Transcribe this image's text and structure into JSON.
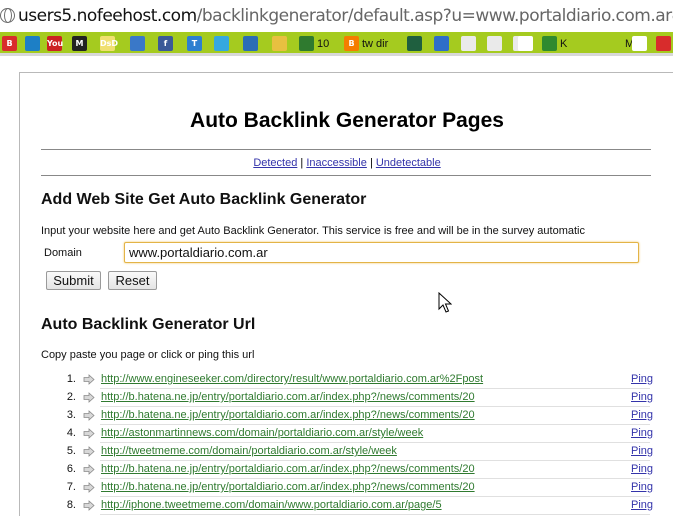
{
  "address_bar": {
    "host": "users5.nofeehost.com",
    "path": "/backlinkgenerator/default.asp?u=www.portaldiario.com.ar&btnkirim=Submit"
  },
  "bookmarks": [
    {
      "icon": "red-b-icon",
      "color": "#d82c2c",
      "text": "B"
    },
    {
      "icon": "blue-square-icon",
      "color": "#1d7fc6",
      "text": ""
    },
    {
      "icon": "youtube-icon",
      "color": "#cc2222",
      "text": "You"
    },
    {
      "icon": "m-icon",
      "color": "#222222",
      "text": "M"
    },
    {
      "icon": "dd-icon",
      "color": "#f0e070",
      "text": "DsD"
    },
    {
      "icon": "globe-icon",
      "color": "#3a78c8",
      "text": ""
    },
    {
      "icon": "facebook-icon",
      "color": "#3b5998",
      "text": "f"
    },
    {
      "icon": "t-icon",
      "color": "#2d7fd0",
      "text": "T"
    },
    {
      "icon": "twitter-icon",
      "color": "#35a8e0",
      "text": ""
    },
    {
      "icon": "circle-icon",
      "color": "#2c6db5",
      "text": ""
    },
    {
      "icon": "smiley-icon",
      "color": "#e8c040",
      "text": ""
    },
    {
      "icon": "clock-icon",
      "color": "#2f7a2f",
      "text": "",
      "label": "10"
    },
    {
      "icon": "blogger-icon",
      "color": "#f57d00",
      "text": "B",
      "label": "tw dir"
    },
    {
      "icon": "gear-icon",
      "color": "#1f5f3f",
      "text": ""
    },
    {
      "icon": "arrow-icon",
      "color": "#2e6ec8",
      "text": ""
    },
    {
      "icon": "page-icon",
      "color": "#eaeaea",
      "text": ""
    },
    {
      "icon": "page-icon",
      "color": "#eaeaea",
      "text": ""
    },
    {
      "icon": "page-icon",
      "color": "#eaeaea",
      "text": ""
    },
    {
      "icon": "skull-icon",
      "color": "#ffffff",
      "text": ""
    },
    {
      "icon": "k-icon",
      "color": "#2f8a2f",
      "text": "",
      "label": "K"
    },
    {
      "icon": "m-letter-icon",
      "color": "#a5cb1f",
      "text": "",
      "label": "M"
    },
    {
      "icon": "hat-icon",
      "color": "#ffffff",
      "text": ""
    },
    {
      "icon": "star-icon",
      "color": "#d82c2c",
      "text": ""
    }
  ],
  "page": {
    "title": "Auto Backlink Generator Pages",
    "links": [
      "Detected",
      "Inaccessible",
      "Undetectable"
    ],
    "separator": "|",
    "add_heading": "Add Web Site Get Auto Backlink Generator",
    "intro": "Input your website here and get Auto Backlink Generator. This service is free and will be in the survey automatic",
    "domain_label": "Domain",
    "domain_value": "www.portaldiario.com.ar",
    "submit_label": "Submit",
    "reset_label": "Reset",
    "url_heading": "Auto Backlink Generator Url",
    "copy_text": "Copy paste you page or click or ping this url",
    "ping_label": "Ping",
    "rows": [
      {
        "num": "1.",
        "url": "http://www.engineseeker.com/directory/result/www.portaldiario.com.ar%2Fpost"
      },
      {
        "num": "2.",
        "url": "http://b.hatena.ne.jp/entry/portaldiario.com.ar/index.php?/news/comments/20"
      },
      {
        "num": "3.",
        "url": "http://b.hatena.ne.jp/entry/portaldiario.com.ar/index.php?/news/comments/20"
      },
      {
        "num": "4.",
        "url": "http://astonmartinnews.com/domain/portaldiario.com.ar/style/week"
      },
      {
        "num": "5.",
        "url": "http://tweetmeme.com/domain/portaldiario.com.ar/style/week"
      },
      {
        "num": "6.",
        "url": "http://b.hatena.ne.jp/entry/portaldiario.com.ar/index.php?/news/comments/20"
      },
      {
        "num": "7.",
        "url": "http://b.hatena.ne.jp/entry/portaldiario.com.ar/index.php?/news/comments/20"
      },
      {
        "num": "8.",
        "url": "http://iphone.tweetmeme.com/domain/www.portaldiario.com.ar/page/5"
      }
    ]
  }
}
